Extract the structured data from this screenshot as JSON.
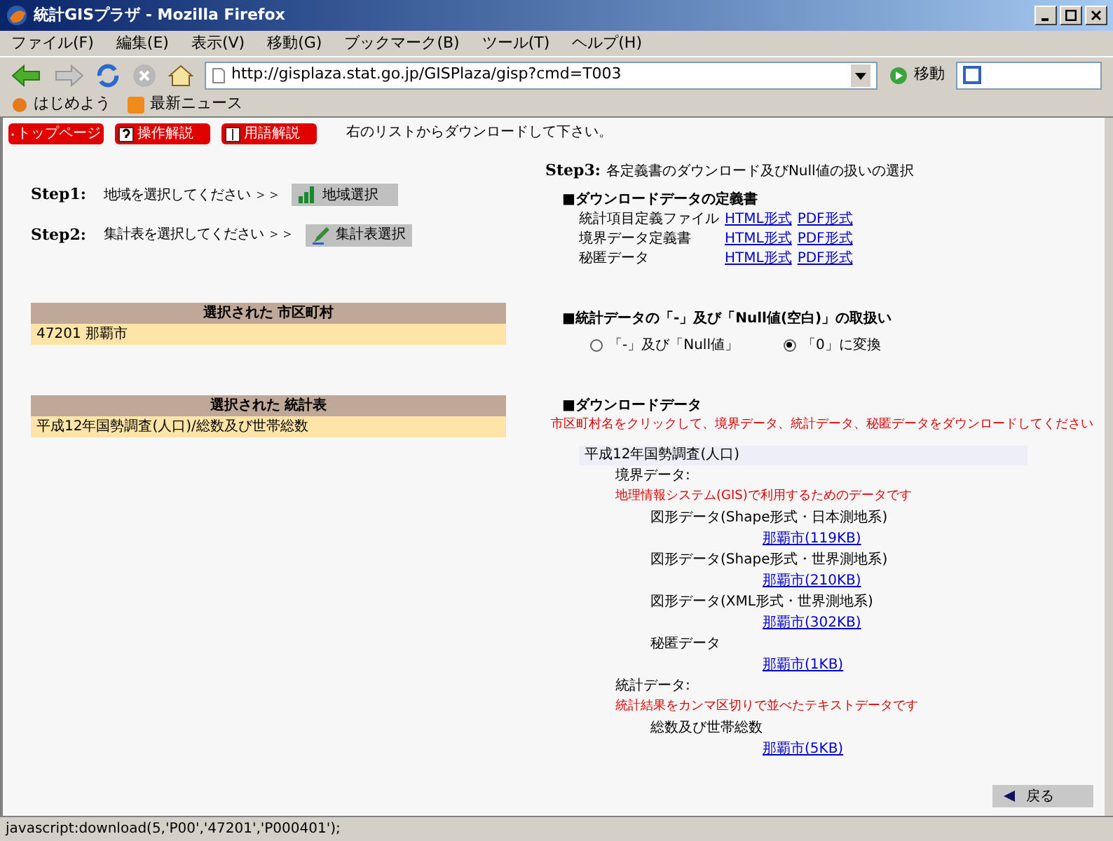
{
  "window": {
    "title": "統計GISプラザ - Mozilla Firefox"
  },
  "menu": [
    "ファイル(F)",
    "編集(E)",
    "表示(V)",
    "移動(G)",
    "ブックマーク(B)",
    "ツール(T)",
    "ヘルプ(H)"
  ],
  "address": {
    "value": "http://gisplaza.stat.go.jp/GISPlaza/gisp?cmd=T003",
    "go": "移動"
  },
  "bookmarks": [
    "はじめよう",
    "最新ニュース"
  ],
  "top_buttons": [
    "トップページ",
    "操作解説",
    "用語解説"
  ],
  "instruction": "右のリストからダウンロードして下さい。",
  "steps": [
    {
      "label": "Step1:",
      "text": "地域を選択してください ＞＞",
      "button": "地域選択",
      "kind": "map"
    },
    {
      "label": "Step2:",
      "text": "集計表を選択してください ＞＞",
      "button": "集計表選択",
      "kind": "pen"
    }
  ],
  "selected_boxes": [
    {
      "title": "選択された 市区町村",
      "value": "47201 那覇市"
    },
    {
      "title": "選択された 統計表",
      "value": "平成12年国勢調査(人口)/総数及び世帯総数"
    }
  ],
  "step3": {
    "label": "Step3:",
    "text": "各定義書のダウンロード及びNull値の扱いの選択"
  },
  "definitions": {
    "heading": "■ダウンロードデータの定義書",
    "rows": [
      {
        "name": "統計項目定義ファイル",
        "links": [
          "HTML形式",
          "PDF形式"
        ]
      },
      {
        "name": "境界データ定義書",
        "links": [
          "HTML形式",
          "PDF形式"
        ]
      },
      {
        "name": "秘匿データ",
        "links": [
          "HTML形式",
          "PDF形式"
        ]
      }
    ]
  },
  "null_handling": {
    "heading": "■統計データの「-」及び「Null値(空白)」の取扱い",
    "options": [
      {
        "label": "「-」及び「Null値」",
        "selected": false
      },
      {
        "label": "「0」に変換",
        "selected": true
      }
    ]
  },
  "downloads": {
    "heading": "■ダウンロードデータ",
    "note": "市区町村名をクリックして、境界データ、統計データ、秘匿データをダウンロードしてください",
    "survey": "平成12年国勢調査(人口)",
    "groups": [
      {
        "label": "境界データ:",
        "note": "地理情報システム(GIS)で利用するためのデータです",
        "items": [
          {
            "label": "図形データ(Shape形式・日本測地系)",
            "link": "那覇市(119KB)"
          },
          {
            "label": "図形データ(Shape形式・世界測地系)",
            "link": "那覇市(210KB)"
          },
          {
            "label": "図形データ(XML形式・世界測地系)",
            "link": "那覇市(302KB)"
          },
          {
            "label": "秘匿データ",
            "link": "那覇市(1KB)"
          }
        ]
      },
      {
        "label": "統計データ:",
        "note": "統計結果をカンマ区切りで並べたテキストデータです",
        "items": [
          {
            "label": "総数及び世帯総数",
            "link": "那覇市(5KB)"
          }
        ]
      }
    ]
  },
  "back_button": "戻る",
  "status_bar": "javascript:download(5,'P00','47201','P000401');"
}
